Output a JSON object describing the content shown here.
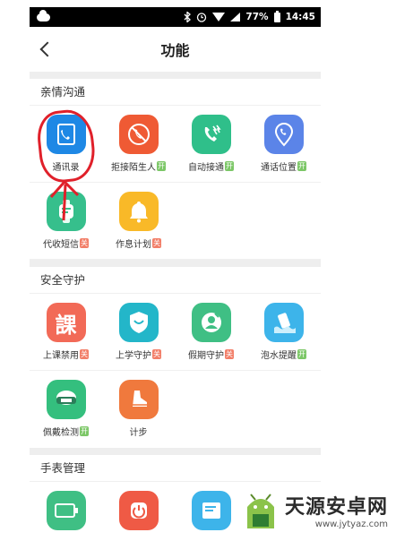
{
  "status_bar": {
    "battery": "77%",
    "time": "14:45"
  },
  "header": {
    "title": "功能"
  },
  "sections": [
    {
      "title": "亲情沟通",
      "items": [
        {
          "label": "通讯录",
          "icon": "contacts-book-icon",
          "color": "#1e88e5",
          "tag": ""
        },
        {
          "label": "拒接陌生人",
          "icon": "blocked-phone-icon",
          "color": "#ef5a34",
          "tag": "开"
        },
        {
          "label": "自动接通",
          "icon": "auto-answer-phone-icon",
          "color": "#2fbf8a",
          "tag": "开"
        },
        {
          "label": "通话位置",
          "icon": "call-location-pin-icon",
          "color": "#5b84e8",
          "tag": "开"
        },
        {
          "label": "代收短信",
          "icon": "watch-message-icon",
          "color": "#36bf8c",
          "tag": "关"
        },
        {
          "label": "作息计划",
          "icon": "bell-icon",
          "color": "#f9b928",
          "tag": "关"
        }
      ]
    },
    {
      "title": "安全守护",
      "items": [
        {
          "label": "上课禁用",
          "icon": "class-ban-icon",
          "color": "#f26a57",
          "glyph": "課",
          "tag": "关"
        },
        {
          "label": "上学守护",
          "icon": "school-shield-icon",
          "color": "#23b6c9",
          "tag": "关"
        },
        {
          "label": "假期守护",
          "icon": "holiday-guard-icon",
          "color": "#3fbf84",
          "tag": "关"
        },
        {
          "label": "泡水提醒",
          "icon": "water-alert-icon",
          "color": "#3db4ea",
          "tag": "开"
        },
        {
          "label": "佩戴检测",
          "icon": "wear-detect-icon",
          "color": "#34bf7e",
          "tag": "开"
        },
        {
          "label": "计步",
          "icon": "shoe-step-icon",
          "color": "#f0793d",
          "tag": ""
        }
      ]
    },
    {
      "title": "手表管理",
      "items": [
        {
          "label": "",
          "icon": "battery-icon",
          "color": "#3fbf84",
          "tag": ""
        },
        {
          "label": "",
          "icon": "power-icon",
          "color": "#ef5a45",
          "tag": ""
        },
        {
          "label": "",
          "icon": "list-doc-icon",
          "color": "#3db4ea",
          "tag": ""
        }
      ]
    }
  ],
  "tags": {
    "on": "开",
    "off": "关"
  },
  "watermark": {
    "title": "天源安卓网",
    "url": "www.jytyaz.com"
  }
}
